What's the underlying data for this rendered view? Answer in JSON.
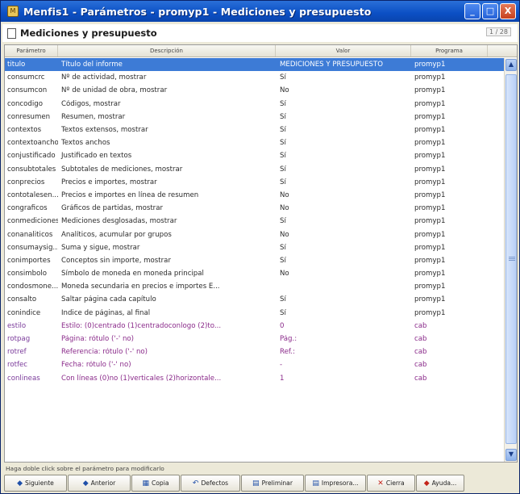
{
  "window": {
    "title": "Menfis1 - Parámetros - promyp1 - Mediciones y presupuesto",
    "buttons": [
      "_",
      "□",
      "X"
    ]
  },
  "header": {
    "title": "Mediciones y presupuesto",
    "counter": "1 / 28"
  },
  "columns": [
    "Parámetro",
    "Descripción",
    "Valor",
    "Programa"
  ],
  "rows": [
    {
      "param": "titulo",
      "desc": "Título del informe",
      "valor": "MEDICIONES Y PRESUPUESTO",
      "prog": "promyp1",
      "selected": true
    },
    {
      "param": "consumcrc",
      "desc": "Nº de actividad, mostrar",
      "valor": "Sí",
      "prog": "promyp1"
    },
    {
      "param": "consumcon",
      "desc": "Nº de unidad de obra, mostrar",
      "valor": "No",
      "prog": "promyp1"
    },
    {
      "param": "concodigo",
      "desc": "Códigos, mostrar",
      "valor": "Sí",
      "prog": "promyp1"
    },
    {
      "param": "conresumen",
      "desc": "Resumen, mostrar",
      "valor": "Sí",
      "prog": "promyp1"
    },
    {
      "param": "contextos",
      "desc": "Textos extensos, mostrar",
      "valor": "Sí",
      "prog": "promyp1"
    },
    {
      "param": "contextoancho",
      "desc": "Textos anchos",
      "valor": "Sí",
      "prog": "promyp1"
    },
    {
      "param": "conjustificado",
      "desc": "Justificado en textos",
      "valor": "Sí",
      "prog": "promyp1"
    },
    {
      "param": "consubtotales",
      "desc": "Subtotales de mediciones, mostrar",
      "valor": "Sí",
      "prog": "promyp1"
    },
    {
      "param": "conprecios",
      "desc": "Precios e importes, mostrar",
      "valor": "Sí",
      "prog": "promyp1"
    },
    {
      "param": "contotalesen...",
      "desc": "Precios e importes en línea de resumen",
      "valor": "No",
      "prog": "promyp1"
    },
    {
      "param": "congraficos",
      "desc": "Gráficos de partidas, mostrar",
      "valor": "No",
      "prog": "promyp1"
    },
    {
      "param": "conmediciones",
      "desc": "Mediciones desglosadas, mostrar",
      "valor": "Sí",
      "prog": "promyp1"
    },
    {
      "param": "conanaliticos",
      "desc": "Analíticos, acumular por grupos",
      "valor": "No",
      "prog": "promyp1"
    },
    {
      "param": "consumaysig...",
      "desc": "Suma y sigue, mostrar",
      "valor": "Sí",
      "prog": "promyp1"
    },
    {
      "param": "conimportes",
      "desc": "Conceptos sin importe, mostrar",
      "valor": "Sí",
      "prog": "promyp1"
    },
    {
      "param": "consimbolo",
      "desc": "Símbolo de moneda en moneda principal",
      "valor": "No",
      "prog": "promyp1"
    },
    {
      "param": "condosmone...",
      "desc": "Moneda secundaria en precios e importes E...",
      "valor": "",
      "prog": "promyp1"
    },
    {
      "param": "consalto",
      "desc": "Saltar página cada capítulo",
      "valor": "Sí",
      "prog": "promyp1"
    },
    {
      "param": "conindice",
      "desc": "Índice de páginas, al final",
      "valor": "Sí",
      "prog": "promyp1"
    },
    {
      "param": "estilo",
      "desc": "Estilo: (0)centrado (1)centradoconlogo (2)to...",
      "valor": "0",
      "prog": "cab",
      "purple": true
    },
    {
      "param": "rotpag",
      "desc": "Página: rótulo ('-' no)",
      "valor": "Pág.:",
      "prog": "cab",
      "purple": true
    },
    {
      "param": "rotref",
      "desc": "Referencia: rótulo ('-' no)",
      "valor": "Ref.:",
      "prog": "cab",
      "purple": true
    },
    {
      "param": "rotfec",
      "desc": "Fecha: rótulo ('-' no)",
      "valor": "-",
      "prog": "cab",
      "purple": true
    },
    {
      "param": "conlineas",
      "desc": "Con líneas (0)no (1)verticales (2)horizontale...",
      "valor": "1",
      "prog": "cab",
      "purple": true
    }
  ],
  "hint": "Haga doble click sobre el parámetro para modificarlo",
  "toolbar": [
    {
      "label": "Siguiente",
      "icon": "down-arrow-icon"
    },
    {
      "label": "Anterior",
      "icon": "up-arrow-icon"
    },
    {
      "label": "Copia",
      "icon": "copy-icon"
    },
    {
      "label": "Defectos",
      "icon": "undo-icon"
    },
    {
      "label": "Preliminar",
      "icon": "preview-icon"
    },
    {
      "label": "Impresora...",
      "icon": "printer-icon"
    },
    {
      "label": "Cierra",
      "icon": "close-icon"
    },
    {
      "label": "Ayuda...",
      "icon": "help-icon"
    }
  ],
  "colors": {
    "selection": "#3d7bd6",
    "purple_rows": "#8a2a8a",
    "titlebar": "#0b4fc4"
  }
}
